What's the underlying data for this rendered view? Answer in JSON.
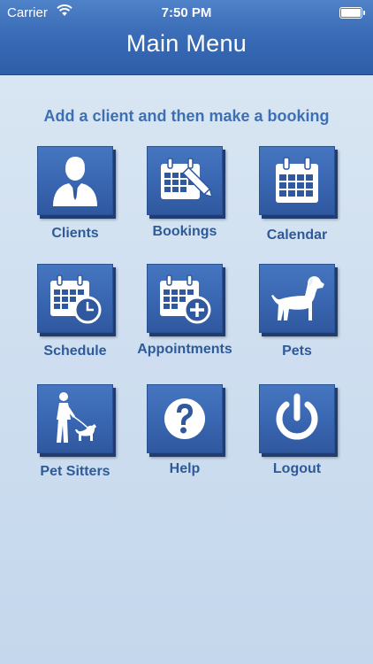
{
  "status_bar": {
    "carrier": "Carrier",
    "time": "7:50 PM"
  },
  "header": {
    "title": "Main Menu"
  },
  "instruction": "Add a client and then make a booking",
  "menu": [
    {
      "label": "Clients",
      "icon": "client-person-icon"
    },
    {
      "label": "Bookings",
      "icon": "calendar-pencil-icon"
    },
    {
      "label": "Calendar",
      "icon": "calendar-icon"
    },
    {
      "label": "Schedule",
      "icon": "calendar-clock-icon"
    },
    {
      "label": "Appointments",
      "icon": "calendar-plus-icon"
    },
    {
      "label": "Pets",
      "icon": "dog-icon"
    },
    {
      "label": "Pet Sitters",
      "icon": "dog-walker-icon"
    },
    {
      "label": "Help",
      "icon": "question-icon"
    },
    {
      "label": "Logout",
      "icon": "power-icon"
    }
  ],
  "colors": {
    "header": "#3a6cb7",
    "tile": "#3a67b2",
    "label": "#2f5a98",
    "background": "#cfdff0"
  }
}
